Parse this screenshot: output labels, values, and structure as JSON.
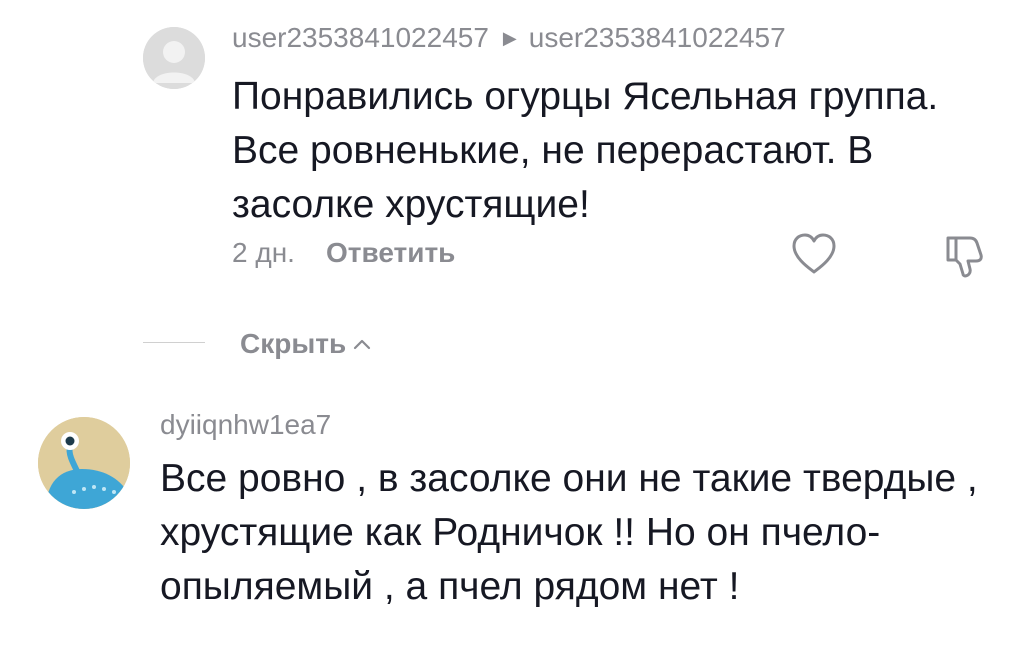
{
  "reply": {
    "author": "user2353841022457",
    "reply_to": "user2353841022457",
    "text": "Понравились огурцы Ясельная группа. Все ровненькие, не перерастают. В засолке хрустящие!",
    "time": "2 дн.",
    "reply_label": "Ответить"
  },
  "thread": {
    "hide_label": "Скрыть"
  },
  "comment": {
    "author": "dyiiqnhw1ea7",
    "text": "Все ровно , в засолке они не такие твердые , хрустящие как Родничок !! Но он пчело-опыляемый , а пчел рядом нет !"
  },
  "icons": {
    "like": "heart-outline-icon",
    "dislike": "thumbs-down-outline-icon",
    "reply_arrow": "triangle-right-icon",
    "hide_chevron": "chevron-up-icon"
  },
  "colors": {
    "text_primary": "#161823",
    "text_secondary": "#8a8b91",
    "avatar_placeholder": "#dcdcdc",
    "avatar_main_bg": "#dfcd9d",
    "avatar_main_figure": "#3ea6d6"
  }
}
